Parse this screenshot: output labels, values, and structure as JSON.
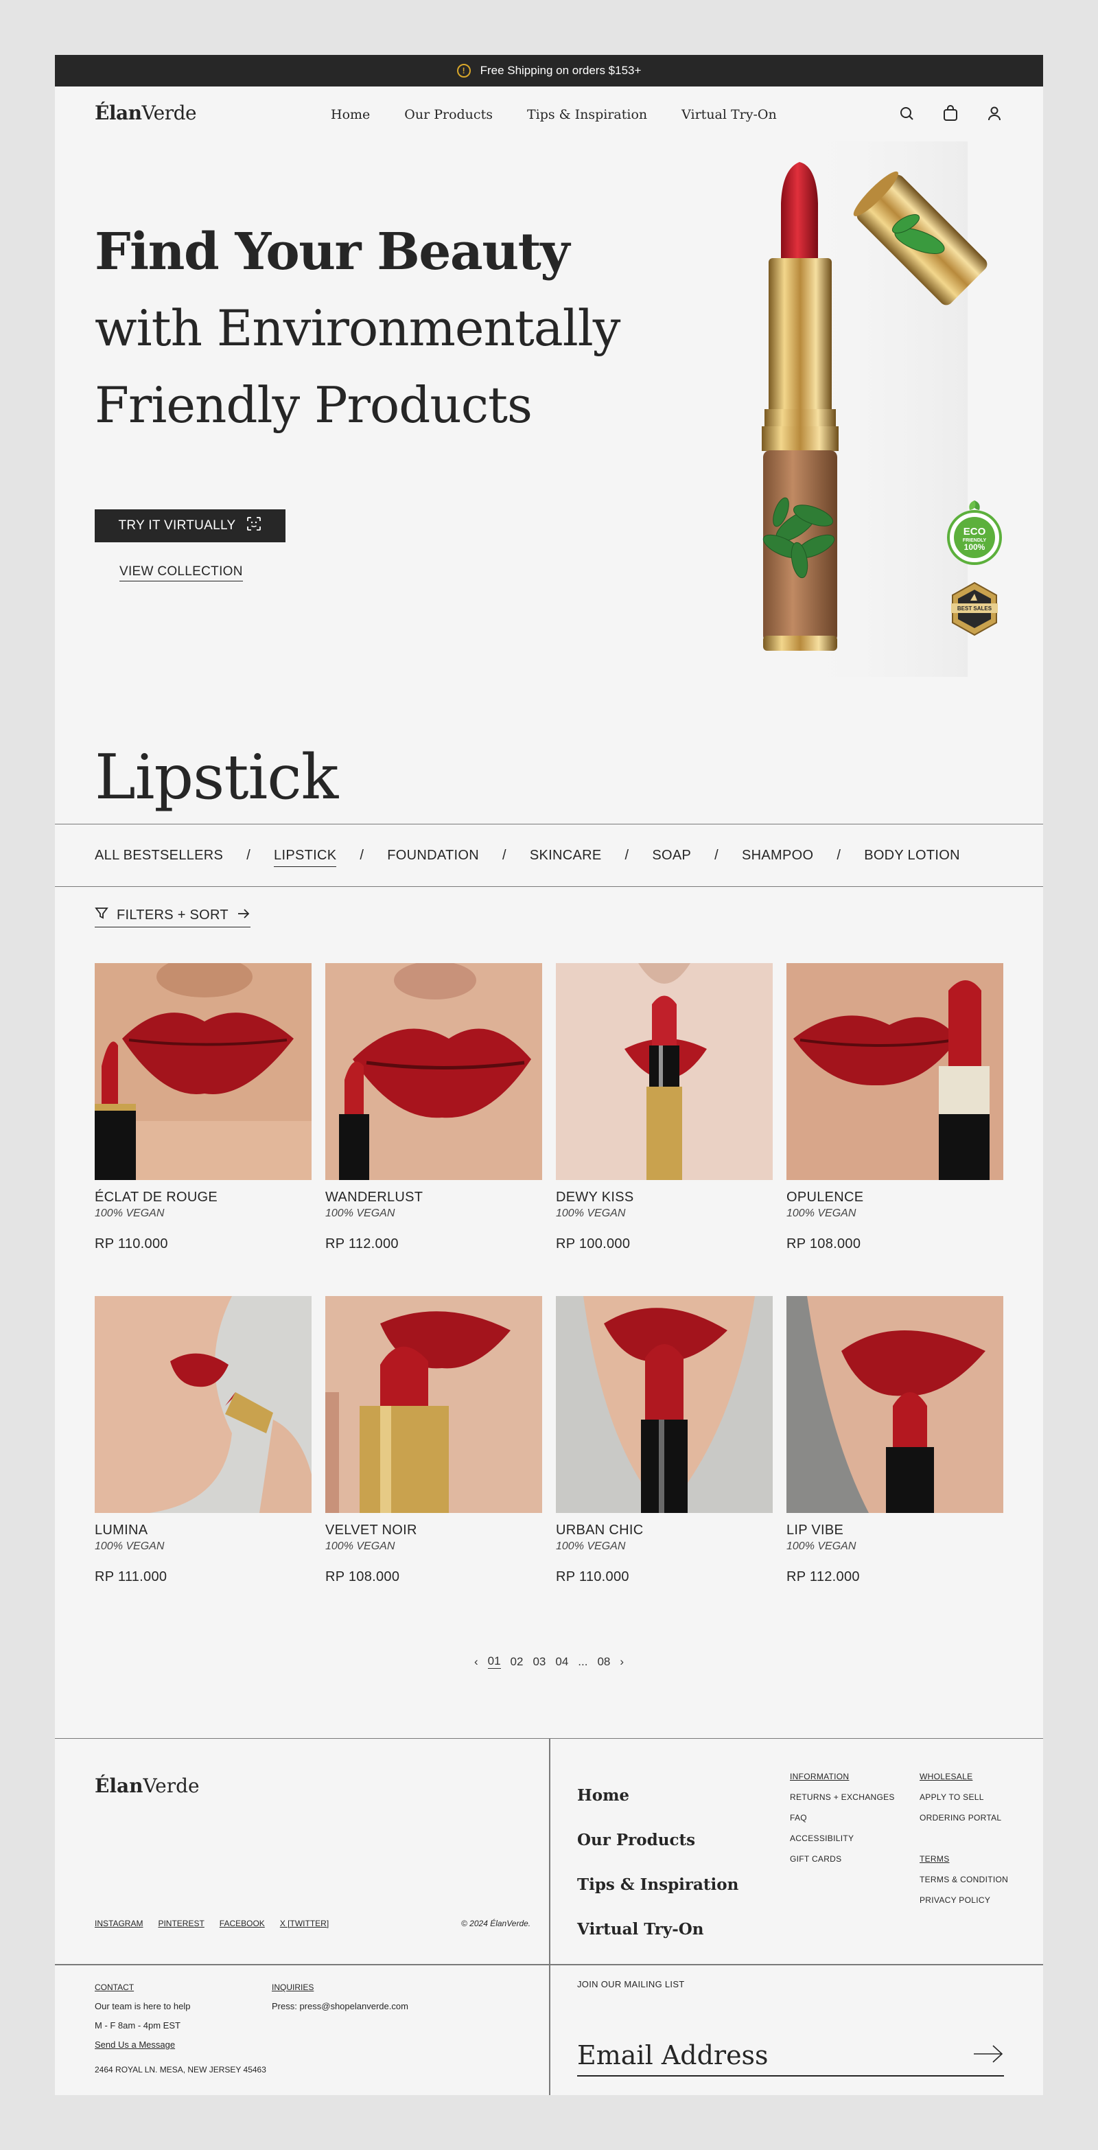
{
  "announcement": {
    "text": "Free Shipping on orders $153+"
  },
  "header": {
    "logo_bold": "Élan",
    "logo_rest": "Verde",
    "nav": [
      "Home",
      "Our Products",
      "Tips & Inspiration",
      "Virtual Try-On"
    ]
  },
  "hero": {
    "title_line1": "Find Your Beauty",
    "title_line2": "with Environmentally",
    "title_line3": "Friendly Products",
    "primary_button": "TRY IT VIRTUALLY",
    "secondary_button": "VIEW COLLECTION",
    "eco_badge": {
      "line1": "ECO",
      "line2": "FRIENDLY",
      "line3": "100%"
    },
    "best_badge": "BEST SALES"
  },
  "section": {
    "title": "Lipstick",
    "categories": [
      "ALL BESTSELLERS",
      "LIPSTICK",
      "FOUNDATION",
      "SKINCARE",
      "SOAP",
      "SHAMPOO",
      "BODY LOTION"
    ],
    "active_category": "LIPSTICK",
    "filters_label": "FILTERS + SORT"
  },
  "products": [
    {
      "name": "ÉCLAT DE ROUGE",
      "tag": "100% VEGAN",
      "price": "RP 110.000"
    },
    {
      "name": "WANDERLUST",
      "tag": "100% VEGAN",
      "price": "RP 112.000"
    },
    {
      "name": "DEWY KISS",
      "tag": "100% VEGAN",
      "price": "RP 100.000"
    },
    {
      "name": "OPULENCE",
      "tag": "100% VEGAN",
      "price": "RP 108.000"
    },
    {
      "name": "LUMINA",
      "tag": "100% VEGAN",
      "price": "RP 111.000"
    },
    {
      "name": "VELVET NOIR",
      "tag": "100% VEGAN",
      "price": "RP 108.000"
    },
    {
      "name": "URBAN CHIC",
      "tag": "100% VEGAN",
      "price": "RP 110.000"
    },
    {
      "name": "LIP VIBE",
      "tag": "100% VEGAN",
      "price": "RP 112.000"
    }
  ],
  "pagination": {
    "prev": "‹",
    "pages": [
      "01",
      "02",
      "03",
      "04",
      "...",
      "08"
    ],
    "current": "01",
    "next": "›"
  },
  "footer": {
    "logo_bold": "Élan",
    "logo_rest": "Verde",
    "social": [
      "INSTAGRAM",
      "PINTEREST",
      "FACEBOOK",
      "X [TWITTER]"
    ],
    "copyright": "© 2024 ÉlanVerde.",
    "nav": [
      "Home",
      "Our Products",
      "Tips & Inspiration",
      "Virtual Try-On"
    ],
    "info_col": {
      "heading": "INFORMATION",
      "links": [
        "RETURNS + EXCHANGES",
        "FAQ",
        "ACCESSIBILITY",
        "GIFT CARDS"
      ]
    },
    "wholesale_col": {
      "heading": "WHOLESALE",
      "links": [
        "APPLY TO SELL",
        "ORDERING PORTAL"
      ]
    },
    "terms_col": {
      "heading": "TERMS",
      "links": [
        "TERMS & CONDITION",
        "PRIVACY POLICY"
      ]
    },
    "contact": {
      "heading": "CONTACT",
      "line1": "Our team is here to help",
      "line2": "M - F 8am - 4pm EST",
      "message_link": "Send Us a Message",
      "address": "2464 ROYAL LN. MESA, NEW JERSEY 45463"
    },
    "inquiries": {
      "heading": "INQUIRIES",
      "press": "Press: press@shopelanverde.com"
    },
    "mailing": {
      "heading": "JOIN OUR MAILING LIST",
      "placeholder": "Email Address"
    }
  },
  "colors": {
    "dark": "#272727",
    "background": "#f5f5f5",
    "lip_red": "#b01c24",
    "eco_green": "#5cb03c",
    "gold": "#c9a24e"
  }
}
